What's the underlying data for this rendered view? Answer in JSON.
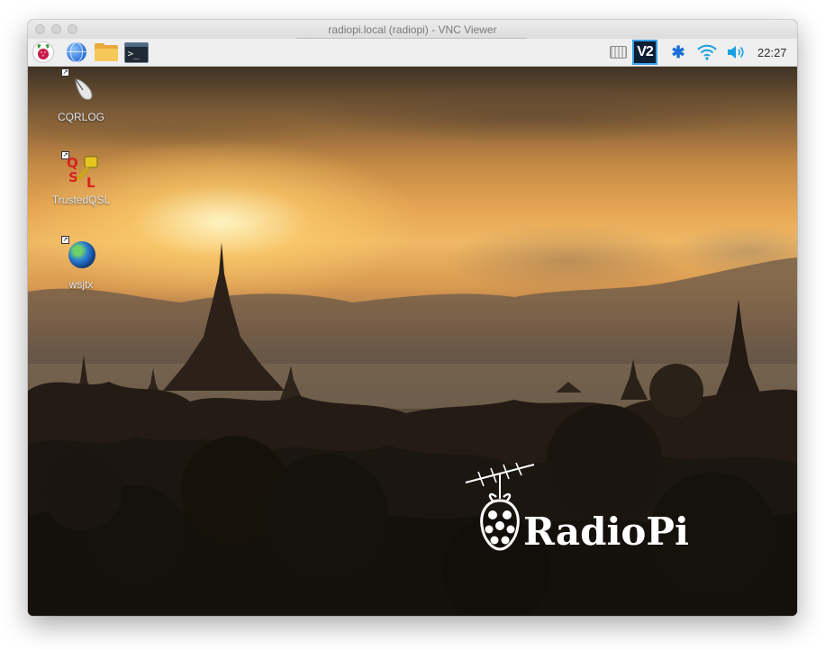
{
  "window": {
    "title": "radiopi.local (radiopi) - VNC Viewer"
  },
  "panel": {
    "launchers": [
      {
        "name": "raspberry-menu",
        "icon": "raspberry-icon"
      },
      {
        "name": "web-browser",
        "icon": "globe-icon"
      },
      {
        "name": "file-manager",
        "icon": "folder-icon"
      },
      {
        "name": "terminal",
        "icon": "terminal-icon",
        "glyph": ">_"
      }
    ],
    "tray": {
      "keyboard_icon": "keyboard-icon",
      "vnc_label": "V2",
      "bluetooth_glyph": "✱",
      "wifi_icon": "wifi-icon",
      "volume_icon": "volume-icon",
      "clock": "22:27"
    }
  },
  "desktop": {
    "icons": [
      {
        "label": "CQRLOG",
        "icon": "cqrlog-icon"
      },
      {
        "label": "TrustedQSL",
        "icon": "qsl-icon"
      },
      {
        "label": "wsjtx",
        "icon": "globe-icon"
      }
    ],
    "logo_text": "RadioPi"
  },
  "colors": {
    "panel_bg": "#efefef",
    "vnc_accent": "#3aa0e8",
    "bluetooth": "#1d6fd6",
    "wifi": "#1aa0e0",
    "raspberry": "#c51a4a"
  }
}
